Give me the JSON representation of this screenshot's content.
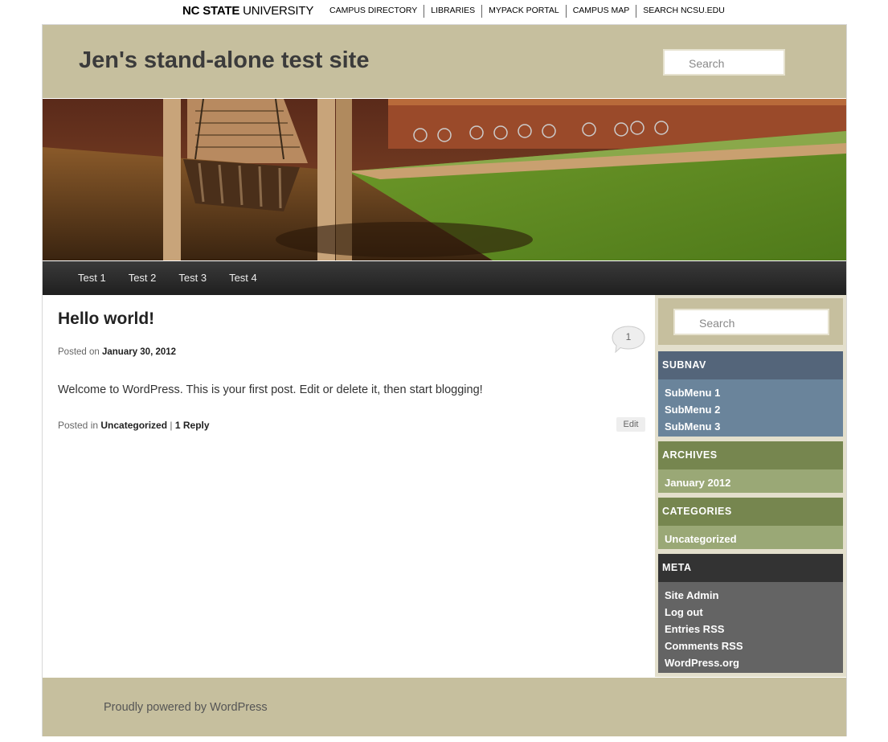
{
  "ncsu_bar": {
    "logo_bold": "NC STATE",
    "logo_rest": " UNIVERSITY",
    "links": [
      "CAMPUS DIRECTORY",
      "LIBRARIES",
      "MYPACK PORTAL",
      "CAMPUS MAP",
      "SEARCH NCSU.EDU"
    ]
  },
  "header": {
    "site_title": "Jen's stand-alone test site",
    "search_placeholder": "Search"
  },
  "nav": {
    "items": [
      "Test 1",
      "Test 2",
      "Test 3",
      "Test 4"
    ]
  },
  "post": {
    "title": "Hello world!",
    "posted_on_label": "Posted on ",
    "date": "January 30, 2012",
    "comment_count": "1",
    "body": "Welcome to WordPress. This is your first post. Edit or delete it, then start blogging!",
    "posted_in_label": "Posted in ",
    "category": "Uncategorized",
    "separator": " | ",
    "reply_link": "1 Reply",
    "edit_label": "Edit"
  },
  "sidebar": {
    "search_placeholder": "Search",
    "subnav": {
      "title": "SUBNAV",
      "items": [
        "SubMenu 1",
        "SubMenu 2",
        "SubMenu 3"
      ]
    },
    "archives": {
      "title": "ARCHIVES",
      "items": [
        "January 2012"
      ]
    },
    "categories": {
      "title": "CATEGORIES",
      "items": [
        "Uncategorized"
      ]
    },
    "meta": {
      "title": "META",
      "items": [
        "Site Admin",
        "Log out",
        "Entries RSS",
        "Comments RSS",
        "WordPress.org"
      ]
    }
  },
  "footer": {
    "text": "Proudly powered by WordPress"
  },
  "colors": {
    "header_tan": "#c6bf9e",
    "nav_dark": "#2a2a2a",
    "subnav_header": "#54657a",
    "subnav_body": "#6a849b",
    "green_header": "#76864f",
    "green_body": "#9aa876",
    "meta_header": "#333333",
    "meta_body": "#646464"
  }
}
